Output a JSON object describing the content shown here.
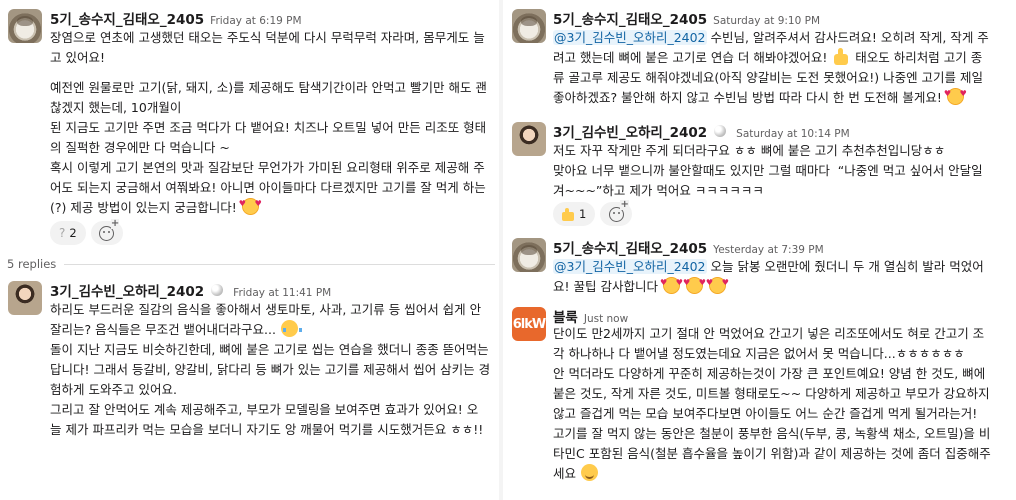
{
  "left": {
    "root": {
      "name": "5기_송수지_김태오_2405",
      "time": "Friday at 6:19 PM",
      "lines": [
        "장염으로 연초에 고생했던 태오는 주도식 덕분에 다시 무럭무럭 자라며, 몸무게도 늘",
        "고 있어요!",
        "",
        "예전엔 원물로만 고기(닭, 돼지, 소)를 제공해도 탐색기간이라 안먹고 빨기만 해도 괜",
        "찮겠지 했는데, 10개월이",
        "된 지금도 고기만 주면 조금 먹다가 다 뱉어요! 치즈나 오트밀 넣어 만든 리조또 형태",
        "의 질퍽한 경우에만 다 먹습니다 ~",
        "혹시 이렇게 고기 본연의 맛과 질감보단 무언가가 가미된 요리형태 위주로 제공해 주",
        "어도 되는지 궁금해서 여쭤봐요! 아니면 아이들마다 다르겠지만 고기를 잘 먹게 하는",
        "(?) 제공 방법이 있는지 궁금합니다!"
      ],
      "reaction_count": "2"
    },
    "replies_label": "5 replies",
    "reply": {
      "name": "3기_김수빈_오하리_2402",
      "time": "Friday at 11:41 PM",
      "lines": [
        "하리도 부드러운 질감의 음식을 좋아해서 생토마토, 사과, 고기류 등 씹어서 쉽게 안",
        "잘리는? 음식들은 무조건 뱉어내더라구요...",
        "돌이 지난 지금도 비슷하긴한데, 뼈에 붙은 고기로 씹는 연습을 했더니 종종 뜯어먹는",
        "답니다! 그래서 등갈비, 양갈비, 닭다리 등 뼈가 있는 고기를 제공해서 씹어 삼키는 경",
        "험하게 도와주고 있어요.",
        "그리고 잘 안먹어도 계속 제공해주고, 부모가 모델링을 보여주면 효과가 있어요! 오",
        "늘 제가 파프리카 먹는 모습을 보더니 자기도 앙 깨물어 먹기를 시도했거든요 ㅎㅎ!!"
      ]
    }
  },
  "right": {
    "m1": {
      "name": "5기_송수지_김태오_2405",
      "time": "Saturday at 9:10 PM",
      "mention": "@3기_김수빈_오하리_2402",
      "line1_rest": " 수빈님, 알려주셔서 감사드려요! 오히려 작게, 작게 주",
      "line2_a": "려고 했는데 뼈에 붙은 고기로 연습 더 해봐야겠어요!",
      "line2_b": " 태오도 하리처럼 고기 종",
      "lines_rest": [
        "류 골고루 제공도 해줘야겠네요(아직 양갈비는 도전 못했어요!) 나중엔 고기를 제일",
        "좋아하겠죠? 불안해 하지 않고 수빈님 방법 따라 다시 한 번 도전해 볼게요!"
      ]
    },
    "m2": {
      "name": "3기_김수빈_오하리_2402",
      "time": "Saturday at 10:14 PM",
      "lines": [
        "저도 자꾸 작게만 주게 되더라구요 ㅎㅎ 뼈에 붙은 고기 추천추천입니당ㅎㅎ",
        "맞아요 너무 뱉으니까 불안할때도 있지만 그럴 때마다  “나중엔 먹고 싶어서 안달일",
        "겨~~~”하고 제가 먹어요 ㅋㅋㅋㅋㅋㅋ"
      ],
      "reaction_count": "1"
    },
    "m3": {
      "name": "5기_송수지_김태오_2405",
      "time": "Yesterday at 7:39 PM",
      "mention": "@3기_김수빈_오하리_2402",
      "line1_rest": " 오늘 닭봉 오랜만에 줬더니 두 개 열심히 발라 먹었어",
      "line2": "요! 꿀팁 감사합니다"
    },
    "m4": {
      "name": "블룩",
      "time": "Just now",
      "lines": [
        "단이도 만2세까지 고기 절대 안 먹었어요 간고기 넣은 리조또에서도 혀로 간고기 조",
        "각 하나하나 다 뱉어낼 정도였는데요 지금은 없어서 못 먹습니다...ㅎㅎㅎㅎㅎㅎ",
        "안 먹더라도 다양하게 꾸준히 제공하는것이 가장 큰 포인트예요! 양념 한 것도, 뼈에",
        "붙은 것도, 작게 자른 것도, 미트볼 형태로도~~ 다양하게 제공하고 부모가 강요하지",
        "않고 즐겁게 먹는 모습 보여주다보면 아이들도 어느 순간 즐겁게 먹게 될거라는거!",
        "고기를 잘 먹지 않는 동안은 철분이 풍부한 음식(두부, 콩, 녹황색 채소, 오트밀)을 비",
        "타민C 포함된 음식(철분 흡수율을 높이기 위함)과 같이 제공하는 것에 좀더 집중해주"
      ],
      "last": "세요",
      "avatar_text": "6lkW"
    }
  }
}
